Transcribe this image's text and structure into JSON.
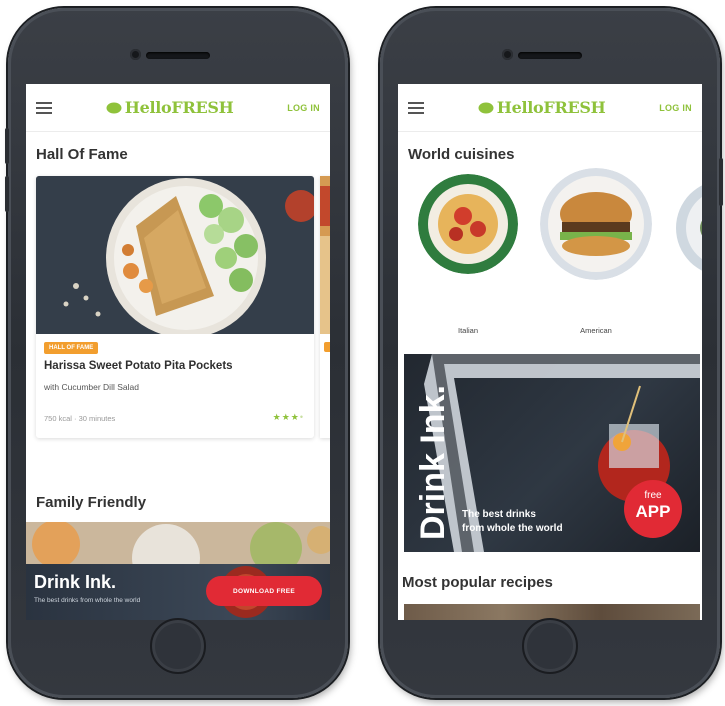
{
  "colors": {
    "brand_green": "#8fc23b",
    "cta_red": "#e12a35",
    "badge_orange": "#f29e2e",
    "phone_body": "#2f333a"
  },
  "app": {
    "logo": "HelloFRESH",
    "login": "LOG IN"
  },
  "left_screen": {
    "section_hof": "Hall Of Fame",
    "card": {
      "badge": "HALL OF FAME",
      "title": "Harissa Sweet Potato Pita Pockets",
      "subtitle": "with Cucumber Dill Salad",
      "meta": "750 kcal · 30 minutes",
      "rating": 3
    },
    "section_family": "Family Friendly",
    "banner": {
      "title": "Drink Ink.",
      "subtitle": "The best drinks from whole the world",
      "button": "DOWNLOAD FREE"
    }
  },
  "right_screen": {
    "section_world": "World cuisines",
    "cuisines": [
      "Italian",
      "American"
    ],
    "drink_banner": {
      "title": "Drink Ink.",
      "caption_line1": "The best drinks",
      "caption_line2": "from whole the world",
      "badge_free": "free",
      "badge_app": "APP"
    },
    "section_popular": "Most popular recipes"
  },
  "icons": [
    "menu-icon",
    "logo-leaf-icon",
    "star-icon",
    "home-button-icon"
  ]
}
